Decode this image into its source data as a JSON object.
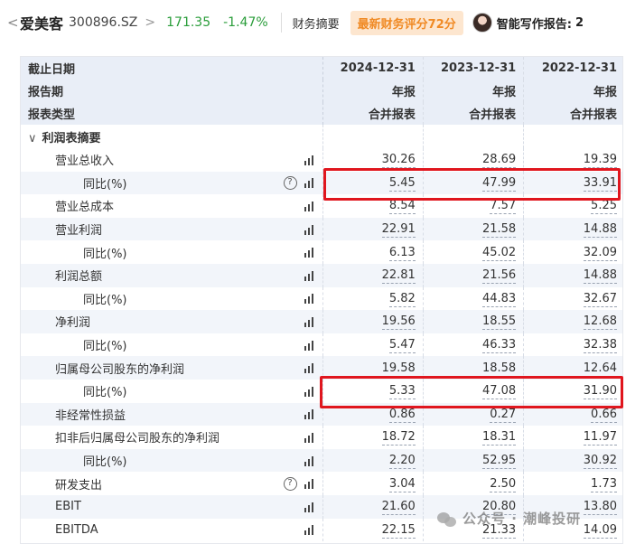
{
  "topbar": {
    "back": "<",
    "stock_name": "爱美客",
    "stock_code": "300896.SZ",
    "chevron": ">",
    "price": "171.35",
    "change": "-1.47%",
    "tab_financial": "财务摘要",
    "rating_badge": "最新财务评分72分",
    "ai_report": "智能写作报告:",
    "ai_trail": "2",
    "colors": {
      "down": "#2a9d3a",
      "badge_bg": "#fde6cf",
      "badge_text": "#f08a24"
    }
  },
  "table": {
    "header_rows": [
      {
        "label": "截止日期",
        "values": [
          "2024-12-31",
          "2023-12-31",
          "2022-12-31"
        ]
      },
      {
        "label": "报告期",
        "values": [
          "年报",
          "年报",
          "年报"
        ]
      },
      {
        "label": "报表类型",
        "values": [
          "合并报表",
          "合并报表",
          "合并报表"
        ]
      }
    ],
    "section": "利润表摘要",
    "rows": [
      {
        "label": "营业总收入",
        "values": [
          "30.26",
          "28.69",
          "19.39"
        ]
      },
      {
        "label": "同比(%)",
        "values": [
          "5.45",
          "47.99",
          "33.91"
        ]
      },
      {
        "label": "营业总成本",
        "values": [
          "8.54",
          "7.57",
          "5.25"
        ]
      },
      {
        "label": "营业利润",
        "values": [
          "22.91",
          "21.58",
          "14.88"
        ]
      },
      {
        "label": "同比(%)",
        "values": [
          "6.13",
          "45.02",
          "32.09"
        ]
      },
      {
        "label": "利润总额",
        "values": [
          "22.81",
          "21.56",
          "14.88"
        ]
      },
      {
        "label": "同比(%)",
        "values": [
          "5.82",
          "44.83",
          "32.67"
        ]
      },
      {
        "label": "净利润",
        "values": [
          "19.56",
          "18.55",
          "12.68"
        ]
      },
      {
        "label": "同比(%)",
        "values": [
          "5.47",
          "46.33",
          "32.38"
        ]
      },
      {
        "label": "归属母公司股东的净利润",
        "values": [
          "19.58",
          "18.58",
          "12.64"
        ]
      },
      {
        "label": "同比(%)",
        "values": [
          "5.33",
          "47.08",
          "31.90"
        ]
      },
      {
        "label": "非经常性损益",
        "values": [
          "0.86",
          "0.27",
          "0.66"
        ]
      },
      {
        "label": "扣非后归属母公司股东的净利润",
        "values": [
          "18.72",
          "18.31",
          "11.97"
        ]
      },
      {
        "label": "同比(%)",
        "values": [
          "2.20",
          "52.95",
          "30.92"
        ]
      },
      {
        "label": "研发支出",
        "values": [
          "3.04",
          "2.50",
          "1.73"
        ]
      },
      {
        "label": "EBIT",
        "values": [
          "21.60",
          "20.80",
          "13.80"
        ]
      },
      {
        "label": "EBITDA",
        "values": [
          "22.15",
          "21.33",
          "14.09"
        ]
      }
    ]
  },
  "watermark": "公众号 · 潮峰投研",
  "highlight_color": "#e0161e"
}
